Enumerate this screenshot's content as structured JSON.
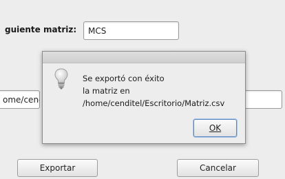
{
  "form": {
    "matrix_label": "guiente matriz:",
    "matrix_value": "MCS",
    "path_value": "ome/cenc",
    "export_label": "Exportar",
    "cancel_label": "Cancelar"
  },
  "dialog": {
    "icon": "lightbulb-icon",
    "message_line1": "Se exportó con éxito",
    "message_line2": "la matriz en",
    "message_line3": "/home/cenditel/Escritorio/Matriz.csv",
    "ok_label": "OK"
  }
}
